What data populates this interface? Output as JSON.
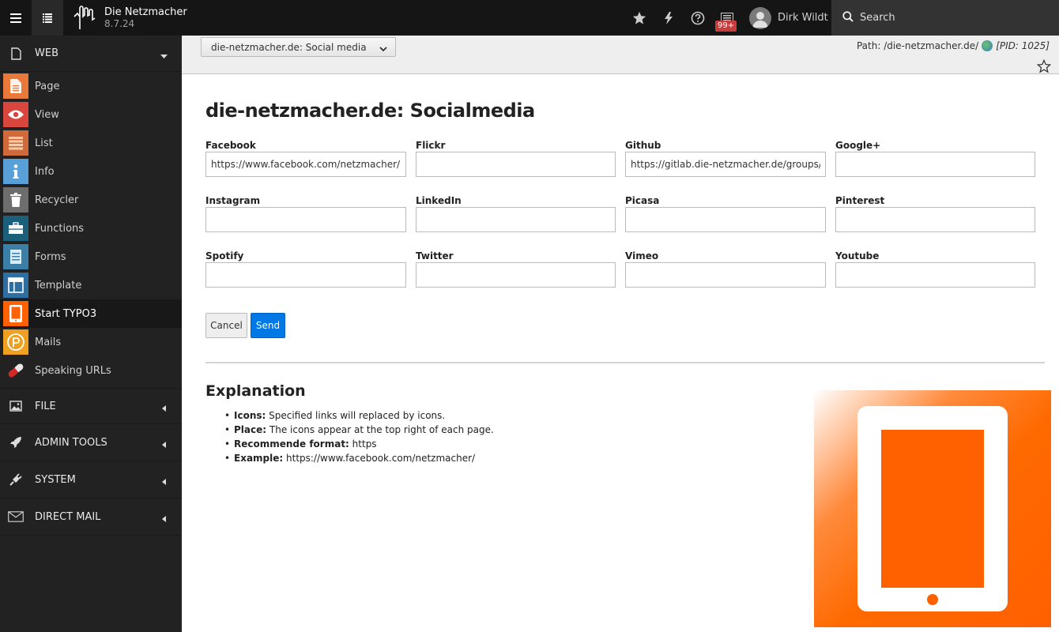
{
  "topbar": {
    "site_name": "Die Netzmacher",
    "version": "8.7.24",
    "badge": "99+",
    "username": "Dirk Wildt",
    "search_placeholder": "Search"
  },
  "sidebar": {
    "web_label": "WEB",
    "modules": [
      {
        "label": "Page",
        "color": "#e8793b"
      },
      {
        "label": "View",
        "color": "#d9463e"
      },
      {
        "label": "List",
        "color": "#d06a3a"
      },
      {
        "label": "Info",
        "color": "#5aa0d8"
      },
      {
        "label": "Recycler",
        "color": "#6d6d6d"
      },
      {
        "label": "Functions",
        "color": "#1c5f7a"
      },
      {
        "label": "Forms",
        "color": "#3b7fa8"
      },
      {
        "label": "Template",
        "color": "#2f6ea0"
      },
      {
        "label": "Start TYPO3",
        "color": "#ff6000"
      },
      {
        "label": "Mails",
        "color": "#f0a020"
      },
      {
        "label": "Speaking URLs",
        "color": "#222222"
      }
    ],
    "file_label": "FILE",
    "admin_label": "ADMIN TOOLS",
    "system_label": "SYSTEM",
    "directmail_label": "DIRECT MAIL"
  },
  "docheader": {
    "page_select": "die-netzmacher.de: Social media",
    "path_label": "Path: /die-netzmacher.de/",
    "pid": "[PID: 1025]"
  },
  "form": {
    "title": "die-netzmacher.de: Socialmedia",
    "fields": [
      {
        "label": "Facebook",
        "value": "https://www.facebook.com/netzmacher/"
      },
      {
        "label": "Flickr",
        "value": ""
      },
      {
        "label": "Github",
        "value": "https://gitlab.die-netzmacher.de/groups/"
      },
      {
        "label": "Google+",
        "value": ""
      },
      {
        "label": "Instagram",
        "value": ""
      },
      {
        "label": "LinkedIn",
        "value": ""
      },
      {
        "label": "Picasa",
        "value": ""
      },
      {
        "label": "Pinterest",
        "value": ""
      },
      {
        "label": "Spotify",
        "value": ""
      },
      {
        "label": "Twitter",
        "value": ""
      },
      {
        "label": "Vimeo",
        "value": ""
      },
      {
        "label": "Youtube",
        "value": ""
      }
    ],
    "cancel_label": "Cancel",
    "send_label": "Send"
  },
  "explanation": {
    "title": "Explanation",
    "items": [
      {
        "key": "Icons:",
        "text": " Specified links will replaced by icons."
      },
      {
        "key": "Place:",
        "text": " The icons appear at the top right of each page."
      },
      {
        "key": "Recommende format:",
        "text": " https"
      },
      {
        "key": "Example:",
        "text": " https://www.facebook.com/netzmacher/"
      }
    ]
  },
  "colors": {
    "accent": "#0078e6",
    "typo3_orange": "#ff6000",
    "topbar": "#151515",
    "sidebar": "#222222"
  }
}
